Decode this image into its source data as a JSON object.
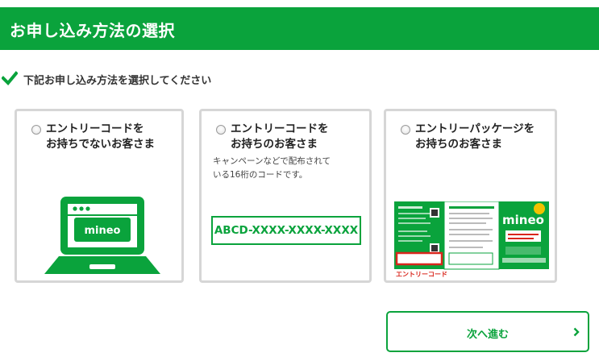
{
  "header": {
    "title": "お申し込み方法の選択"
  },
  "instruction": {
    "text": "下記お申し込み方法を選択してください"
  },
  "options": [
    {
      "title_line1": "エントリーコードを",
      "title_line2": "お持ちでないお客さま",
      "laptop_logo": "mineo"
    },
    {
      "title_line1": "エントリーコードを",
      "title_line2": "お持ちのお客さま",
      "desc_line1": "キャンペーンなどで配布されて",
      "desc_line2": "いる16桁のコードです。",
      "code_sample": "ABCD-XXXX-XXXX-XXXX"
    },
    {
      "title_line1": "エントリーパッケージを",
      "title_line2": "お持ちのお客さま",
      "package_logo": "mineo",
      "package_caption": "エントリーコード"
    }
  ],
  "next_button": {
    "label": "次へ進む"
  },
  "colors": {
    "brand_green": "#0aa33c",
    "card_border": "#d6d6d6",
    "highlight_red": "#d9261c"
  }
}
